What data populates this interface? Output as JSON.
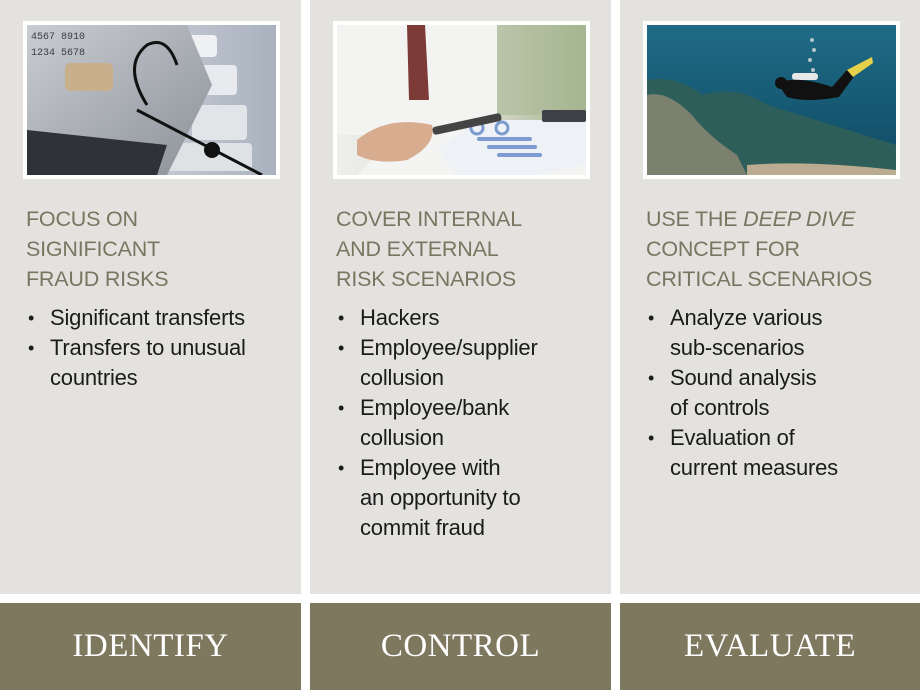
{
  "columns": [
    {
      "image": "credit-card-with-fishing-hook",
      "heading_lines": [
        "FOCUS ON",
        "SIGNIFICANT",
        "FRAUD RISKS"
      ],
      "bullets": [
        {
          "lines": [
            "Significant transferts"
          ]
        },
        {
          "lines": [
            "Transfers to unusual",
            "countries"
          ]
        }
      ],
      "label": "IDENTIFY"
    },
    {
      "image": "magnifying-glass-over-report",
      "heading_lines": [
        "COVER INTERNAL",
        "AND EXTERNAL",
        "RISK SCENARIOS"
      ],
      "bullets": [
        {
          "lines": [
            "Hackers"
          ]
        },
        {
          "lines": [
            "Employee/supplier",
            "collusion"
          ]
        },
        {
          "lines": [
            "Employee/bank",
            "collusion"
          ]
        },
        {
          "lines": [
            "Employee with",
            "an opportunity to",
            "commit fraud"
          ]
        }
      ],
      "label": "CONTROL"
    },
    {
      "image": "scuba-diver-over-reef",
      "heading_lines": [
        "USE THE ",
        "DEEP DIVE",
        "CONCEPT FOR",
        "CRITICAL SCENARIOS"
      ],
      "bullets": [
        {
          "lines": [
            "Analyze various",
            "sub-scenarios"
          ]
        },
        {
          "lines": [
            "Sound analysis",
            "of controls"
          ]
        },
        {
          "lines": [
            "Evaluation of",
            "current measures"
          ]
        }
      ],
      "label": "EVALUATE"
    }
  ],
  "bullet_glyph": "•",
  "colors": {
    "card_bg": "#e3e2df",
    "heading": "#7a7560",
    "band": "#7e785f",
    "band_text": "#ffffff",
    "body_text": "#1b1b1b"
  }
}
